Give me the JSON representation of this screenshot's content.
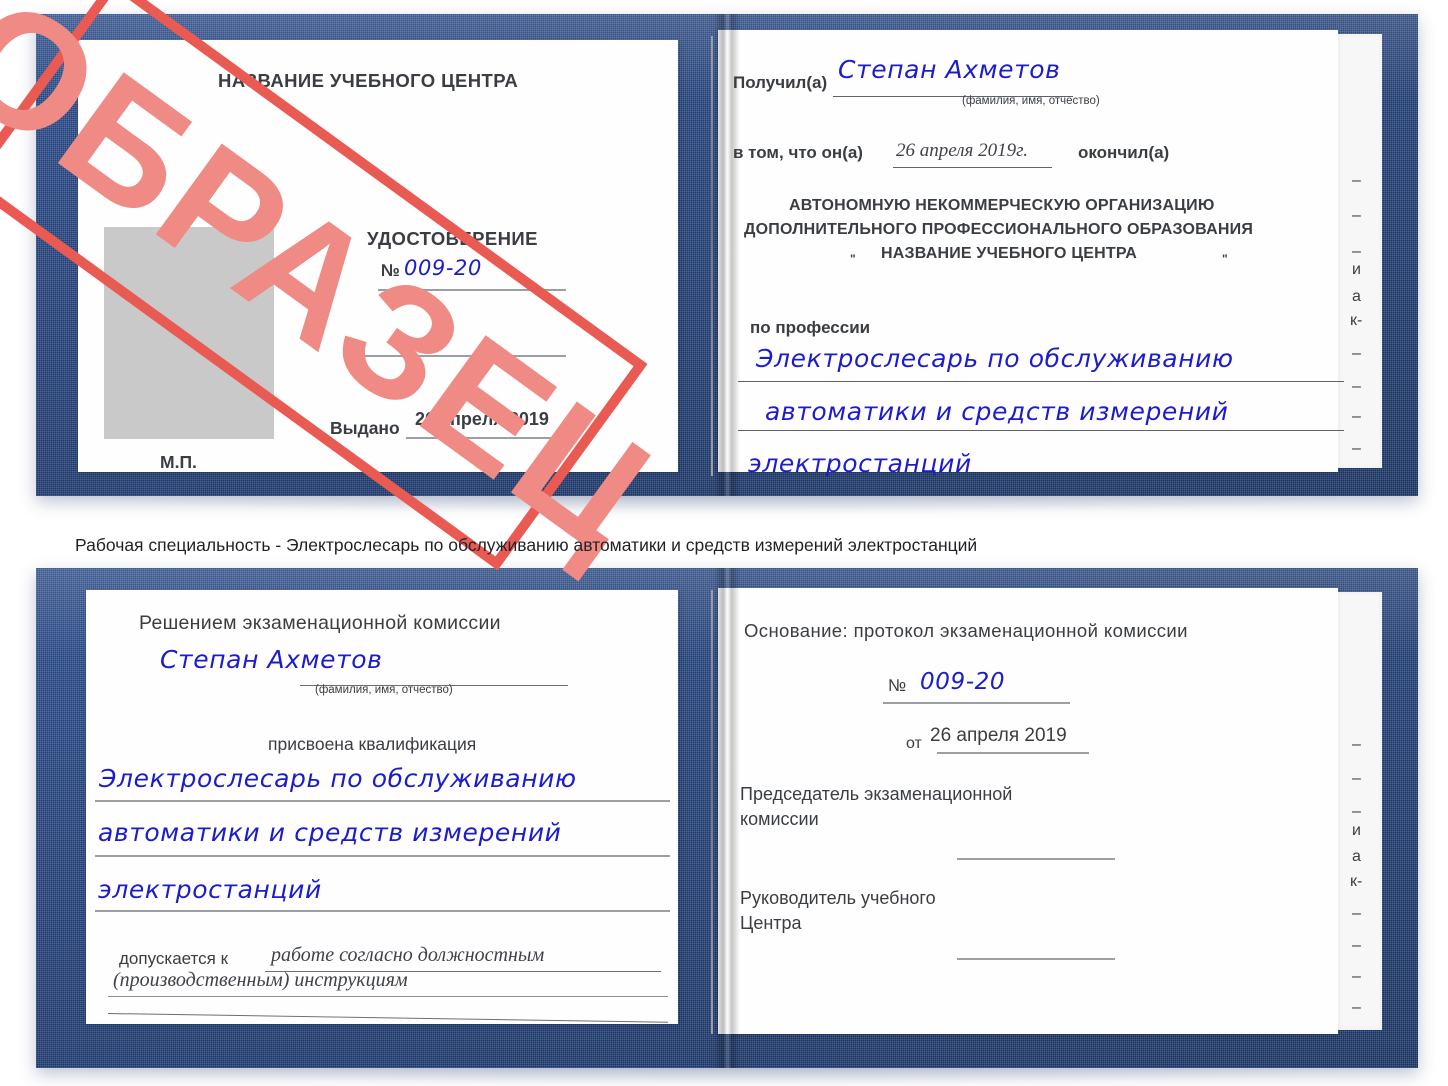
{
  "meta": {
    "doc_kind": "Удостоверение",
    "stamp_label": "ОБРАЗЕЦ",
    "accent_blue": "#24437e",
    "accent_red": "#e85a52",
    "ink_blue": "#1c1ccc",
    "page_white": "#fefefe"
  },
  "caption": {
    "text": "Рабочая специальность - Электрослесарь по обслуживанию автоматики и средств измерений электростанций"
  },
  "cert_top": {
    "left_page": {
      "heading": "НАЗВАНИЕ УЧЕБНОГО ЦЕНТРА",
      "title": "УДОСТОВЕРЕНИЕ",
      "number_label": "№",
      "number_value": "009-20",
      "issued_label": "Выдано",
      "issued_value": "26 апреля 2019",
      "seal_label": "М.П.",
      "photo_placeholder": "photo-box"
    },
    "right_page": {
      "received_label": "Получил(а)",
      "received_value": "Степан Ахметов",
      "fio_hint": "(фамилия, имя, отчество)",
      "that_label": "в том, что он(а)",
      "that_value": "26 апреля 2019г.",
      "finished_label": "окончил(а)",
      "org_line1": "АВТОНОМНУЮ НЕКОММЕРЧЕСКУЮ ОРГАНИЗАЦИЮ",
      "org_line2": "ДОПОЛНИТЕЛЬНОГО ПРОФЕССИОНАЛЬНОГО ОБРАЗОВАНИЯ",
      "org_quote_open": "\"",
      "org_line3": "НАЗВАНИЕ УЧЕБНОГО ЦЕНТРА",
      "org_quote_close": "\"",
      "profession_label": "по профессии",
      "profession_line1": "Электрослесарь по обслуживанию",
      "profession_line2": "автоматики и средств измерений",
      "profession_line3": "электростанций"
    },
    "edge_marks": [
      "–",
      "–",
      "–",
      "и",
      "а",
      "к-",
      "–",
      "–",
      "–",
      "–"
    ]
  },
  "cert_bottom": {
    "left_page": {
      "heading": "Решением экзаменационной комиссии",
      "name_value": "Степан Ахметов",
      "fio_hint": "(фамилия, имя, отчество)",
      "qualification_label": "присвоена квалификация",
      "qualification_line1": "Электрослесарь по обслуживанию",
      "qualification_line2": "автоматики и средств измерений",
      "qualification_line3": "электростанций",
      "allowed_label": "допускается к",
      "allowed_value_line1": "работе согласно должностным",
      "allowed_value_line2": "(производственным) инструкциям"
    },
    "right_page": {
      "basis_label": "Основание: протокол экзаменационной комиссии",
      "number_label": "№",
      "number_value": "009-20",
      "date_label": "от",
      "date_value": "26 апреля 2019",
      "chairman_line1": "Председатель экзаменационной",
      "chairman_line2": "комиссии",
      "head_line1": "Руководитель учебного",
      "head_line2": "Центра"
    },
    "edge_marks": [
      "–",
      "–",
      "–",
      "и",
      "а",
      "к-",
      "–",
      "–",
      "–",
      "–"
    ]
  }
}
